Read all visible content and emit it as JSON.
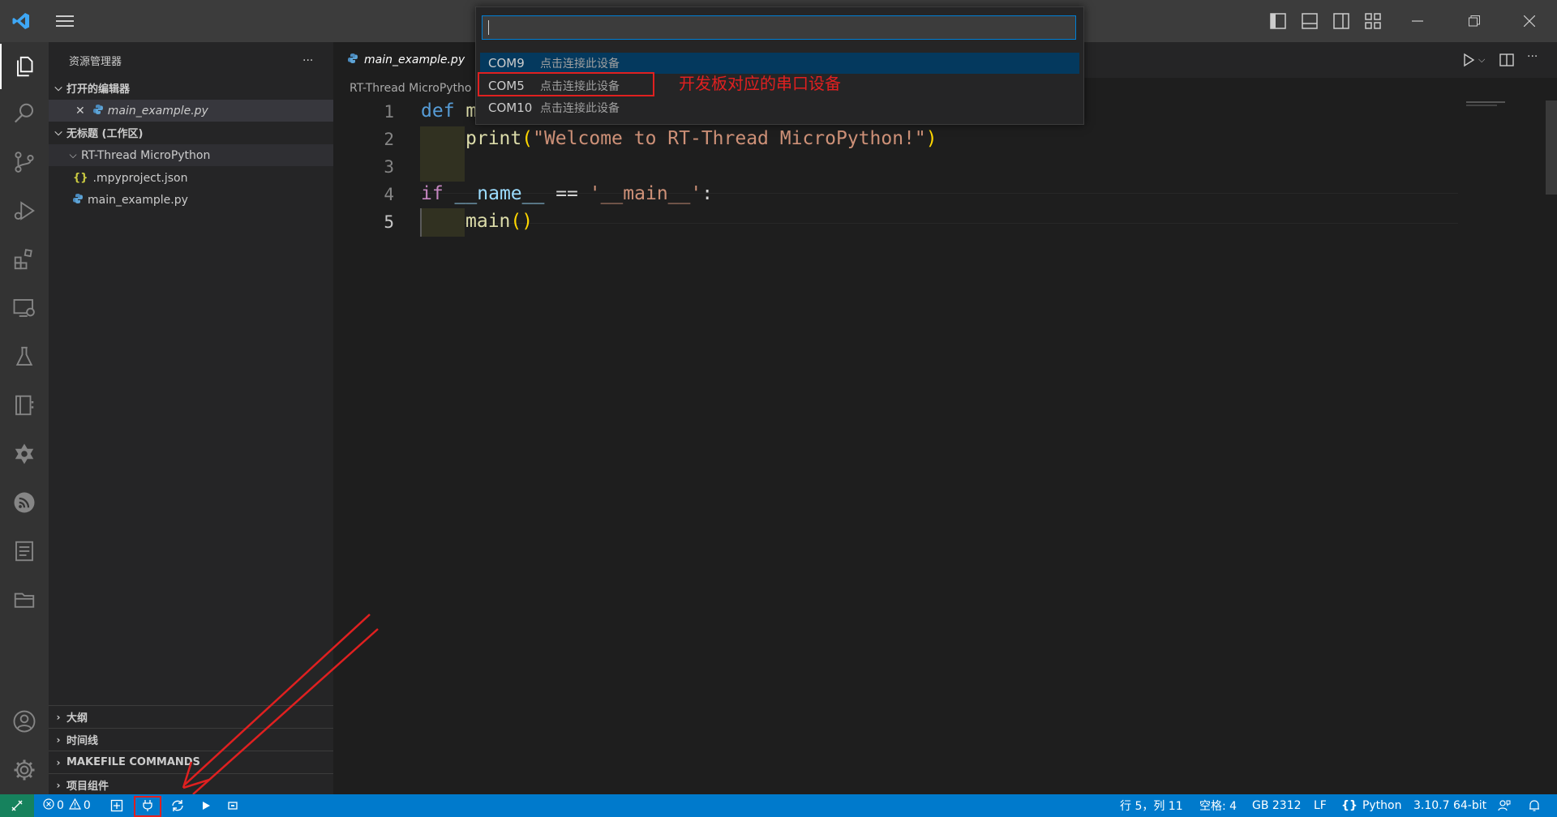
{
  "sidebar": {
    "title": "资源管理器",
    "more": "···",
    "open_editors_label": "打开的编辑器",
    "open_editor_file": "main_example.py",
    "workspace_label": "无标题 (工作区)",
    "folder": "RT-Thread MicroPython",
    "files": [
      ".mpyproject.json",
      "main_example.py"
    ],
    "sections": [
      "大纲",
      "时间线",
      "MAKEFILE COMMANDS",
      "项目组件"
    ]
  },
  "editor": {
    "tab_label": "main_example.py",
    "breadcrumb": "RT-Thread MicroPytho",
    "line_numbers": [
      "1",
      "2",
      "3",
      "4",
      "5"
    ],
    "code": {
      "l1_kw": "def",
      "l1_rest": " m",
      "l2_fn": "print",
      "l2_open": "(",
      "l2_str": "\"Welcome to RT-Thread MicroPython!\"",
      "l2_close": ")",
      "l4_kw": "if",
      "l4_name": " __name__ ",
      "l4_op": "== ",
      "l4_str": "'__main__'",
      "l4_colon": ":",
      "l5_fn": "main",
      "l5_paren": "()"
    }
  },
  "quick_pick": {
    "items": [
      {
        "label": "COM9",
        "desc": "点击连接此设备"
      },
      {
        "label": "COM5",
        "desc": "点击连接此设备"
      },
      {
        "label": "COM10",
        "desc": "点击连接此设备"
      }
    ]
  },
  "annotation": {
    "text": "开发板对应的串口设备",
    "color": "#e02020"
  },
  "statusbar": {
    "errors": "0",
    "warnings": "0",
    "position": "行 5，列 11",
    "spaces": "空格: 4",
    "encoding": "GB 2312",
    "eol": "LF",
    "language": "Python",
    "interpreter": "3.10.7 64-bit"
  },
  "colors": {
    "accent": "#007acc",
    "keyword": "#569cd6",
    "control_keyword": "#c586c0",
    "function": "#dcdcaa",
    "string": "#ce9178",
    "variable": "#9cdcfe"
  }
}
